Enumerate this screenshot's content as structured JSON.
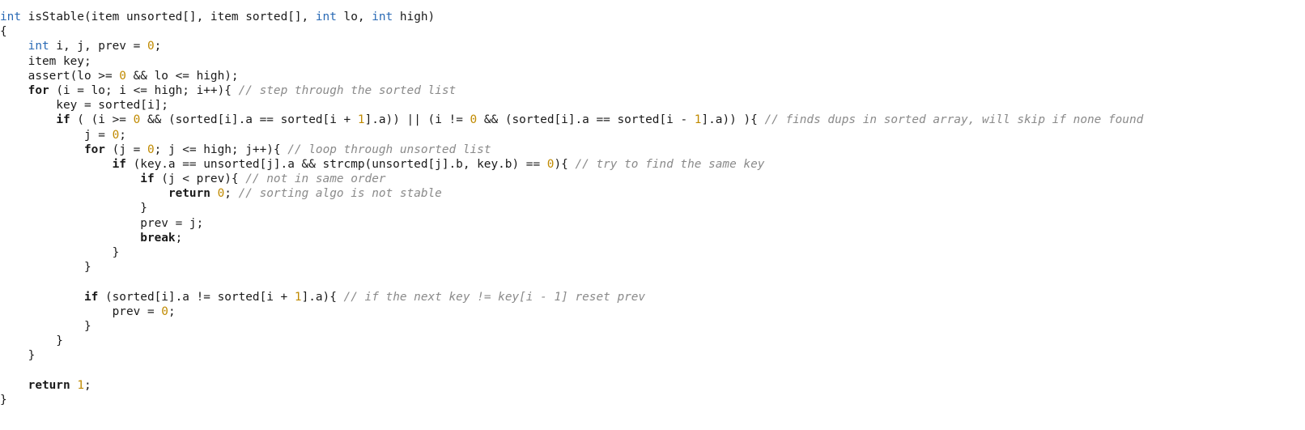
{
  "colors": {
    "background": "#ffffff",
    "plain": "#1a1a1a",
    "type": "#2a6ab5",
    "keyword": "#1a1a1a",
    "number": "#c08a00",
    "comment": "#8a8a8a"
  },
  "code": {
    "lines": [
      [
        [
          "t",
          "int"
        ],
        [
          "p",
          " isStable(item unsorted[], item sorted[], "
        ],
        [
          "t",
          "int"
        ],
        [
          "p",
          " lo, "
        ],
        [
          "t",
          "int"
        ],
        [
          "p",
          " high)"
        ]
      ],
      [
        [
          "p",
          "{"
        ]
      ],
      [
        [
          "p",
          "    "
        ],
        [
          "t",
          "int"
        ],
        [
          "p",
          " i, j, prev = "
        ],
        [
          "n",
          "0"
        ],
        [
          "p",
          ";"
        ]
      ],
      [
        [
          "p",
          "    item key;"
        ]
      ],
      [
        [
          "p",
          "    assert(lo >= "
        ],
        [
          "n",
          "0"
        ],
        [
          "p",
          " && lo <= high);"
        ]
      ],
      [
        [
          "p",
          "    "
        ],
        [
          "k",
          "for"
        ],
        [
          "p",
          " (i = lo; i <= high; i++){ "
        ],
        [
          "c",
          "// step through the sorted list"
        ]
      ],
      [
        [
          "p",
          "        key = sorted[i];"
        ]
      ],
      [
        [
          "p",
          "        "
        ],
        [
          "k",
          "if"
        ],
        [
          "p",
          " ( (i >= "
        ],
        [
          "n",
          "0"
        ],
        [
          "p",
          " && (sorted[i].a == sorted[i + "
        ],
        [
          "n",
          "1"
        ],
        [
          "p",
          "].a)) || (i != "
        ],
        [
          "n",
          "0"
        ],
        [
          "p",
          " && (sorted[i].a == sorted[i - "
        ],
        [
          "n",
          "1"
        ],
        [
          "p",
          "].a)) ){ "
        ],
        [
          "c",
          "// finds dups in sorted array, will skip if none found"
        ]
      ],
      [
        [
          "p",
          "            j = "
        ],
        [
          "n",
          "0"
        ],
        [
          "p",
          ";"
        ]
      ],
      [
        [
          "p",
          "            "
        ],
        [
          "k",
          "for"
        ],
        [
          "p",
          " (j = "
        ],
        [
          "n",
          "0"
        ],
        [
          "p",
          "; j <= high; j++){ "
        ],
        [
          "c",
          "// loop through unsorted list"
        ]
      ],
      [
        [
          "p",
          "                "
        ],
        [
          "k",
          "if"
        ],
        [
          "p",
          " (key.a == unsorted[j].a && strcmp(unsorted[j].b, key.b) == "
        ],
        [
          "n",
          "0"
        ],
        [
          "p",
          "){ "
        ],
        [
          "c",
          "// try to find the same key"
        ]
      ],
      [
        [
          "p",
          "                    "
        ],
        [
          "k",
          "if"
        ],
        [
          "p",
          " (j < prev){ "
        ],
        [
          "c",
          "// not in same order"
        ]
      ],
      [
        [
          "p",
          "                        "
        ],
        [
          "k",
          "return"
        ],
        [
          "p",
          " "
        ],
        [
          "n",
          "0"
        ],
        [
          "p",
          "; "
        ],
        [
          "c",
          "// sorting algo is not stable"
        ]
      ],
      [
        [
          "p",
          "                    }"
        ]
      ],
      [
        [
          "p",
          "                    prev = j;"
        ]
      ],
      [
        [
          "p",
          "                    "
        ],
        [
          "k",
          "break"
        ],
        [
          "p",
          ";"
        ]
      ],
      [
        [
          "p",
          "                }"
        ]
      ],
      [
        [
          "p",
          "            }"
        ]
      ],
      [
        [
          "p",
          ""
        ]
      ],
      [
        [
          "p",
          "            "
        ],
        [
          "k",
          "if"
        ],
        [
          "p",
          " (sorted[i].a != sorted[i + "
        ],
        [
          "n",
          "1"
        ],
        [
          "p",
          "].a){ "
        ],
        [
          "c",
          "// if the next key != key[i - 1] reset prev"
        ]
      ],
      [
        [
          "p",
          "                prev = "
        ],
        [
          "n",
          "0"
        ],
        [
          "p",
          ";"
        ]
      ],
      [
        [
          "p",
          "            }"
        ]
      ],
      [
        [
          "p",
          "        }"
        ]
      ],
      [
        [
          "p",
          "    }"
        ]
      ],
      [
        [
          "p",
          ""
        ]
      ],
      [
        [
          "p",
          "    "
        ],
        [
          "k",
          "return"
        ],
        [
          "p",
          " "
        ],
        [
          "n",
          "1"
        ],
        [
          "p",
          ";"
        ]
      ],
      [
        [
          "p",
          "}"
        ]
      ]
    ]
  }
}
